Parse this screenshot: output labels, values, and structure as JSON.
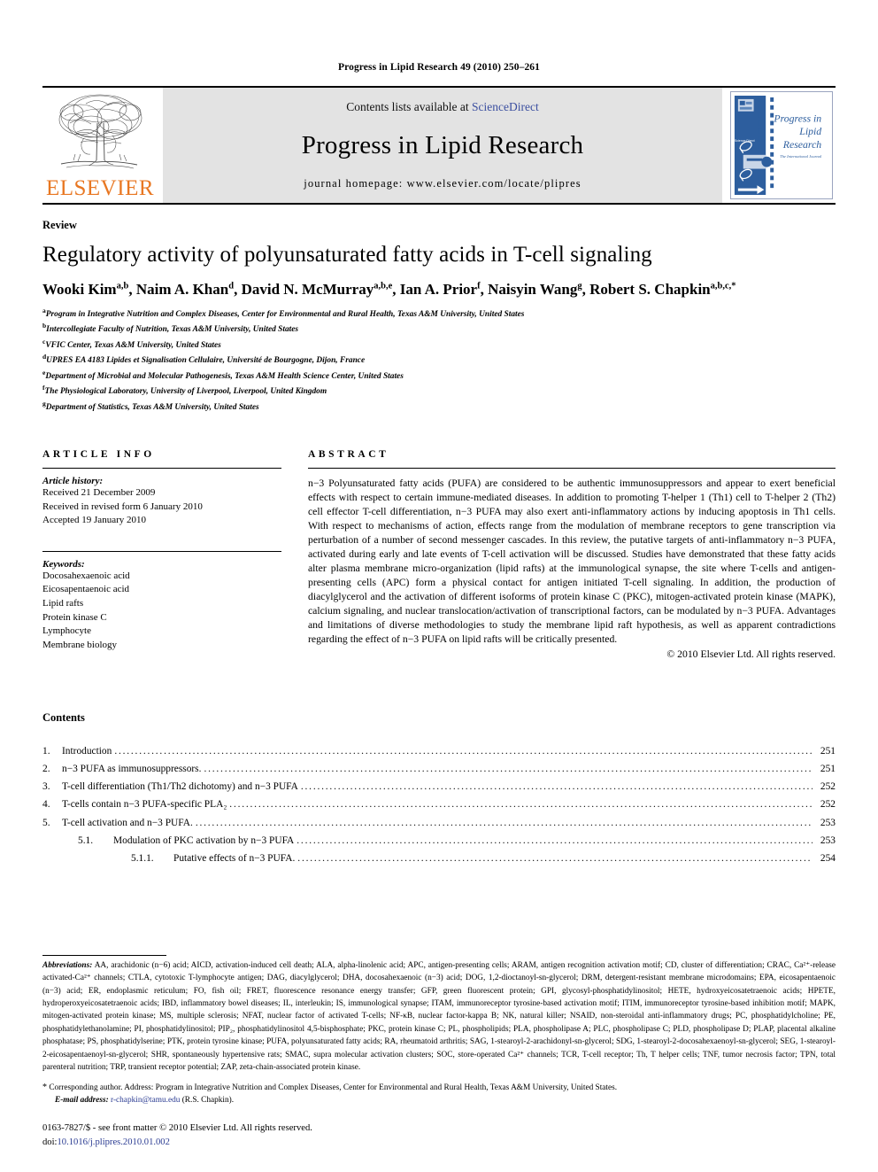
{
  "running_head": "Progress in Lipid Research 49 (2010) 250–261",
  "masthead": {
    "publisher_name": "ELSEVIER",
    "contents_prefix": "Contents lists available at ",
    "contents_link": "ScienceDirect",
    "journal_title": "Progress in Lipid Research",
    "homepage": "journal homepage: www.elsevier.com/locate/plipres",
    "cover_title_line1": "Progress in",
    "cover_title_line2": "Lipid",
    "cover_title_line3": "Research"
  },
  "article": {
    "type_label": "Review",
    "title": "Regulatory activity of polyunsaturated fatty acids in T-cell signaling",
    "authors": [
      {
        "name": "Wooki Kim",
        "sup": "a,b"
      },
      {
        "name": "Naim A. Khan",
        "sup": "d"
      },
      {
        "name": "David N. McMurray",
        "sup": "a,b,e"
      },
      {
        "name": "Ian A. Prior",
        "sup": "f"
      },
      {
        "name": "Naisyin Wang",
        "sup": "g"
      },
      {
        "name": "Robert S. Chapkin",
        "sup": "a,b,c,*"
      }
    ],
    "affiliations": [
      {
        "mark": "a",
        "text": "Program in Integrative Nutrition and Complex Diseases, Center for Environmental and Rural Health, Texas A&M University, United States"
      },
      {
        "mark": "b",
        "text": "Intercollegiate Faculty of Nutrition, Texas A&M University, United States"
      },
      {
        "mark": "c",
        "text": "VFIC Center, Texas A&M University, United States"
      },
      {
        "mark": "d",
        "text": "UPRES EA 4183 Lipides et Signalisation Cellulaire, Université de Bourgogne, Dijon, France"
      },
      {
        "mark": "e",
        "text": "Department of Microbial and Molecular Pathogenesis, Texas A&M Health Science Center, United States"
      },
      {
        "mark": "f",
        "text": "The Physiological Laboratory, University of Liverpool, Liverpool, United Kingdom"
      },
      {
        "mark": "g",
        "text": "Department of Statistics, Texas A&M University, United States"
      }
    ]
  },
  "article_info": {
    "heading": "ARTICLE INFO",
    "history_label": "Article history:",
    "history": [
      "Received 21 December 2009",
      "Received in revised form 6 January 2010",
      "Accepted 19 January 2010"
    ],
    "keywords_label": "Keywords:",
    "keywords": [
      "Docosahexaenoic acid",
      "Eicosapentaenoic acid",
      "Lipid rafts",
      "Protein kinase C",
      "Lymphocyte",
      "Membrane biology"
    ]
  },
  "abstract": {
    "heading": "ABSTRACT",
    "text": "n−3 Polyunsaturated fatty acids (PUFA) are considered to be authentic immunosuppressors and appear to exert beneficial effects with respect to certain immune-mediated diseases. In addition to promoting T-helper 1 (Th1) cell to T-helper 2 (Th2) cell effector T-cell differentiation, n−3 PUFA may also exert anti-inflammatory actions by inducing apoptosis in Th1 cells. With respect to mechanisms of action, effects range from the modulation of membrane receptors to gene transcription via perturbation of a number of second messenger cascades. In this review, the putative targets of anti-inflammatory n−3 PUFA, activated during early and late events of T-cell activation will be discussed. Studies have demonstrated that these fatty acids alter plasma membrane micro-organization (lipid rafts) at the immunological synapse, the site where T-cells and antigen-presenting cells (APC) form a physical contact for antigen initiated T-cell signaling. In addition, the production of diacylglycerol and the activation of different isoforms of protein kinase C (PKC), mitogen-activated protein kinase (MAPK), calcium signaling, and nuclear translocation/activation of transcriptional factors, can be modulated by n−3 PUFA. Advantages and limitations of diverse methodologies to study the membrane lipid raft hypothesis, as well as apparent contradictions regarding the effect of n−3 PUFA on lipid rafts will be critically presented.",
    "copyright": "© 2010 Elsevier Ltd. All rights reserved."
  },
  "contents": {
    "heading": "Contents",
    "entries": [
      {
        "level": 1,
        "number": "1.",
        "label": "Introduction",
        "page": "251"
      },
      {
        "level": 1,
        "number": "2.",
        "label": "n−3 PUFA as immunosuppressors.",
        "page": "251"
      },
      {
        "level": 1,
        "number": "3.",
        "label": "T-cell differentiation (Th1/Th2 dichotomy) and n−3 PUFA",
        "page": "252"
      },
      {
        "level": 1,
        "number": "4.",
        "label": "T-cells contain n−3 PUFA-specific PLA₂",
        "page": "252"
      },
      {
        "level": 1,
        "number": "5.",
        "label": "T-cell activation and n−3 PUFA.",
        "page": "253"
      },
      {
        "level": 2,
        "number": "5.1.",
        "label": "Modulation of PKC activation by n−3 PUFA",
        "page": "253"
      },
      {
        "level": 3,
        "number": "5.1.1.",
        "label": "Putative effects of n−3 PUFA.",
        "page": "254"
      }
    ]
  },
  "footnotes": {
    "abbrev_label": "Abbreviations:",
    "abbrev_text": " AA, arachidonic (n−6) acid; AICD, activation-induced cell death; ALA, alpha-linolenic acid; APC, antigen-presenting cells; ARAM, antigen recognition activation motif; CD, cluster of differentiation; CRAC, Ca²⁺-release activated-Ca²⁺ channels; CTLA, cytotoxic T-lymphocyte antigen; DAG, diacylglycerol; DHA, docosahexaenoic (n−3) acid; DOG, 1,2-dioctanoyl-sn-glycerol; DRM, detergent-resistant membrane microdomains; EPA, eicosapentaenoic (n−3) acid; ER, endoplasmic reticulum; FO, fish oil; FRET, fluorescence resonance energy transfer; GFP, green fluorescent protein; GPI, glycosyl-phosphatidylinositol; HETE, hydroxyeicosatetraenoic acids; HPETE, hydroperoxyeicosatetraenoic acids; IBD, inflammatory bowel diseases; IL, interleukin; IS, immunological synapse; ITAM, immunoreceptor tyrosine-based activation motif; ITIM, immunoreceptor tyrosine-based inhibition motif; MAPK, mitogen-activated protein kinase; MS, multiple sclerosis; NFAT, nuclear factor of activated T-cells; NF-κB, nuclear factor-kappa B; NK, natural killer; NSAID, non-steroidal anti-inflammatory drugs; PC, phosphatidylcholine; PE, phosphatidylethanolamine; PI, phosphatidylinositol; PIP₂, phosphatidylinositol 4,5-bisphosphate; PKC, protein kinase C; PL, phospholipids; PLA, phospholipase A; PLC, phospholipase C; PLD, phospholipase D; PLAP, placental alkaline phosphatase; PS, phosphatidylserine; PTK, protein tyrosine kinase; PUFA, polyunsaturated fatty acids; RA, rheumatoid arthritis; SAG, 1-stearoyl-2-arachidonyl-sn-glycerol; SDG, 1-stearoyl-2-docosahexaenoyl-sn-glycerol; SEG, 1-stearoyl-2-eicosapentaenoyl-sn-glycerol; SHR, spontaneously hypertensive rats; SMAC, supra molecular activation clusters; SOC, store-operated Ca²⁺ channels; TCR, T-cell receptor; Th, T helper cells; TNF, tumor necrosis factor; TPN, total parenteral nutrition; TRP, transient receptor potential; ZAP, zeta-chain-associated protein kinase.",
    "corresponding_prefix": "Corresponding author. Address: Program in Integrative Nutrition and Complex Diseases, Center for Environmental and Rural Health, Texas A&M University, United States.",
    "email_label": "E-mail address:",
    "email": "r-chapkin@tamu.edu",
    "email_suffix": "(R.S. Chapkin).",
    "issn_line": "0163-7827/$ - see front matter © 2010 Elsevier Ltd. All rights reserved.",
    "doi_label": "doi:",
    "doi": "10.1016/j.plipres.2010.01.002"
  },
  "colors": {
    "link": "#2a3b92",
    "sciencedirect": "#3b4fa0",
    "elsevier_orange": "#E87722",
    "masthead_bg": "#e3e3e3",
    "cover_blue": "#2d5e9e"
  }
}
